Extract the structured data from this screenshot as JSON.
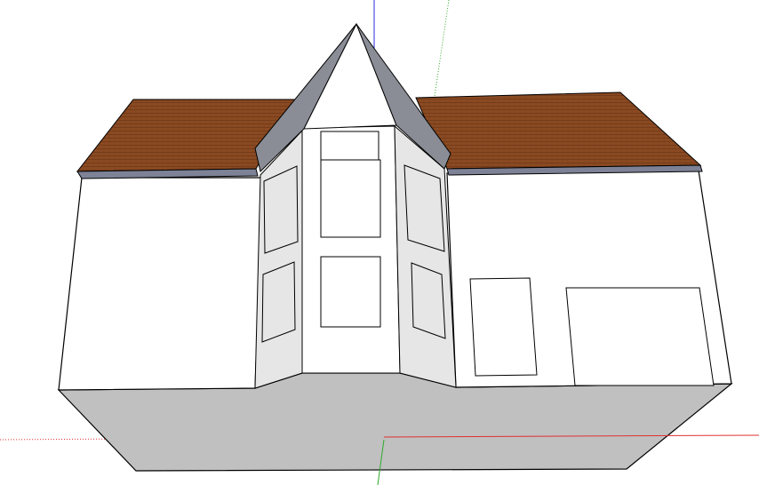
{
  "viewport": {
    "background": "#ffffff"
  },
  "axes": {
    "red_axis_color": "#e03030",
    "green_axis_color": "#2ea82e",
    "blue_axis_color": "#2a2ae0"
  },
  "model": {
    "wall_color": "#ffffff",
    "shaded_side_color": "#c0c0c0",
    "bay_panel_color": "#e6e6e6",
    "roof_shingle_color": "#8b4a22",
    "roof_edge_color": "#7d8296",
    "turret_light_color": "#ffffff",
    "turret_dark_color": "#8a8d95",
    "edge_color": "#000000"
  }
}
